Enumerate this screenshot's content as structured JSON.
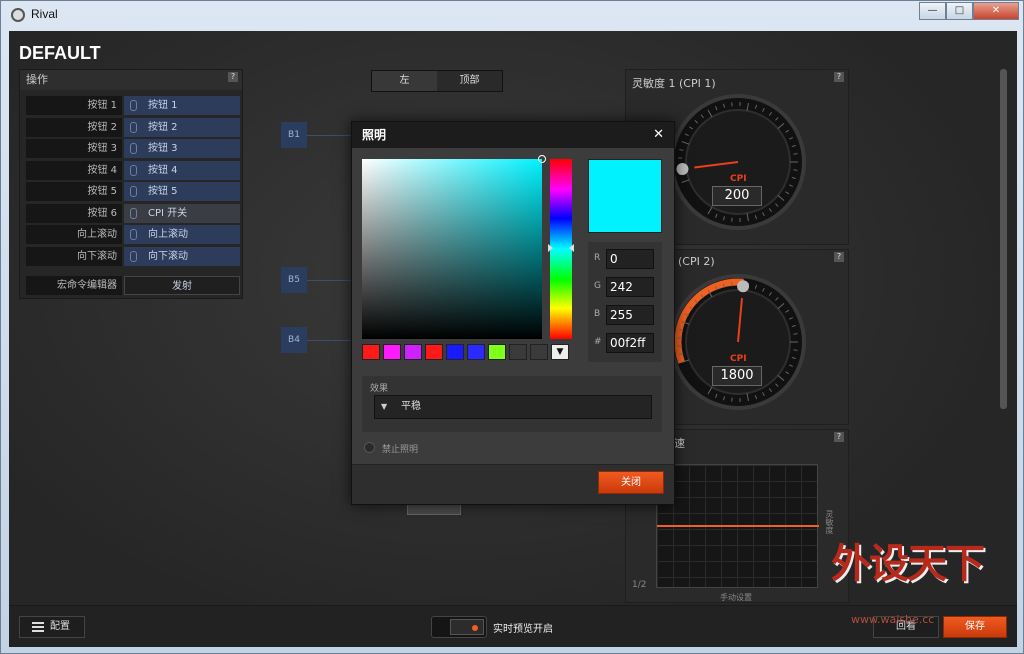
{
  "window": {
    "title": "Rival",
    "min": "—",
    "max": "□",
    "close": "✕"
  },
  "profile_name": "DEFAULT",
  "actions_panel": {
    "title": "操作",
    "help": "?",
    "rows": [
      {
        "label": "按钮 1",
        "value": "按钮 1",
        "style": "blue"
      },
      {
        "label": "按钮 2",
        "value": "按钮 2",
        "style": "blue"
      },
      {
        "label": "按钮 3",
        "value": "按钮 3",
        "style": "blue"
      },
      {
        "label": "按钮 4",
        "value": "按钮 4",
        "style": "blue"
      },
      {
        "label": "按钮 5",
        "value": "按钮 5",
        "style": "blue"
      },
      {
        "label": "按钮 6",
        "value": "CPI 开关",
        "style": "grey"
      },
      {
        "label": "向上滚动",
        "value": "向上滚动",
        "style": "blue"
      },
      {
        "label": "向下滚动",
        "value": "向下滚动",
        "style": "blue"
      }
    ],
    "macro_label": "宏命令编辑器",
    "macro_button": "发射"
  },
  "view_tabs": [
    "左",
    "顶部"
  ],
  "mouse_buttons": [
    "B1",
    "B5",
    "B4"
  ],
  "cpi1": {
    "title": "灵敏度 1 (CPI 1)",
    "unit": "CPI",
    "value": "200",
    "level": 0.04
  },
  "cpi2": {
    "title": "(CPI 2)",
    "unit": "CPI",
    "value": "1800",
    "level": 0.36
  },
  "accel": {
    "title": "速",
    "axis_right": "灵敏度",
    "axis_bottom": "手动设置",
    "page": "1/2"
  },
  "dialog": {
    "title": "照明",
    "close_icon": "✕",
    "selected_color": "#00f2ff",
    "swatches": [
      "#ff1a1a",
      "#ff1aff",
      "#cc22ff",
      "#ff1a1a",
      "#1a1aff",
      "#2a2aff",
      "#7fff1a",
      "#3a3a3a",
      "#3a3a3a"
    ],
    "swatch_dropdown": "▼",
    "rgb": [
      {
        "label": "R",
        "value": "0"
      },
      {
        "label": "G",
        "value": "242"
      },
      {
        "label": "B",
        "value": "255"
      },
      {
        "label": "#",
        "value": "00f2ff"
      }
    ],
    "effect_label": "效果",
    "effect_value": "平稳",
    "disable_label": "禁止照明",
    "close_button": "关闭"
  },
  "bottom": {
    "config_button": "配置",
    "live_preview": "实时预览开启",
    "revert_button": "回看",
    "save_button": "保存"
  },
  "watermark": {
    "text": "外设天下",
    "url": "www.waishe.cc"
  }
}
